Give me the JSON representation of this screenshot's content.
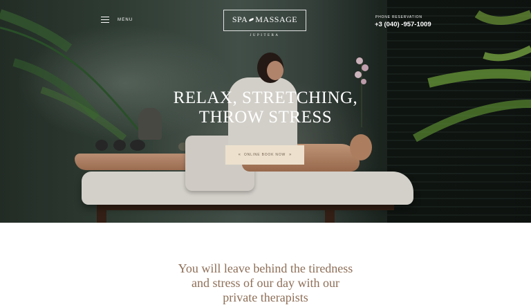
{
  "header": {
    "menu_label": "MENU",
    "logo": {
      "word_left": "SPA",
      "word_right": "MASSAGE",
      "subtitle": "JUPITERA"
    },
    "phone": {
      "label": "PHONE RESERVATION",
      "number": "+3 (040) -957-1009"
    }
  },
  "hero": {
    "title_line1": "RELAX, STRETCHING,",
    "title_line2": "THROW STRESS",
    "cta_label": "ONLINE BOOK NOW",
    "cta_arrow_left": "«",
    "cta_arrow_right": "»"
  },
  "intro": {
    "line1": "You will leave behind the tiredness",
    "line2": "and stress of our day with our",
    "line3": "private therapists"
  },
  "icons": [
    "hamburger-icon",
    "leaf-icon",
    "arrow-left-icon",
    "arrow-right-icon"
  ],
  "colors": {
    "cta_background": "#ede1ce",
    "intro_text": "#8e6f58"
  }
}
